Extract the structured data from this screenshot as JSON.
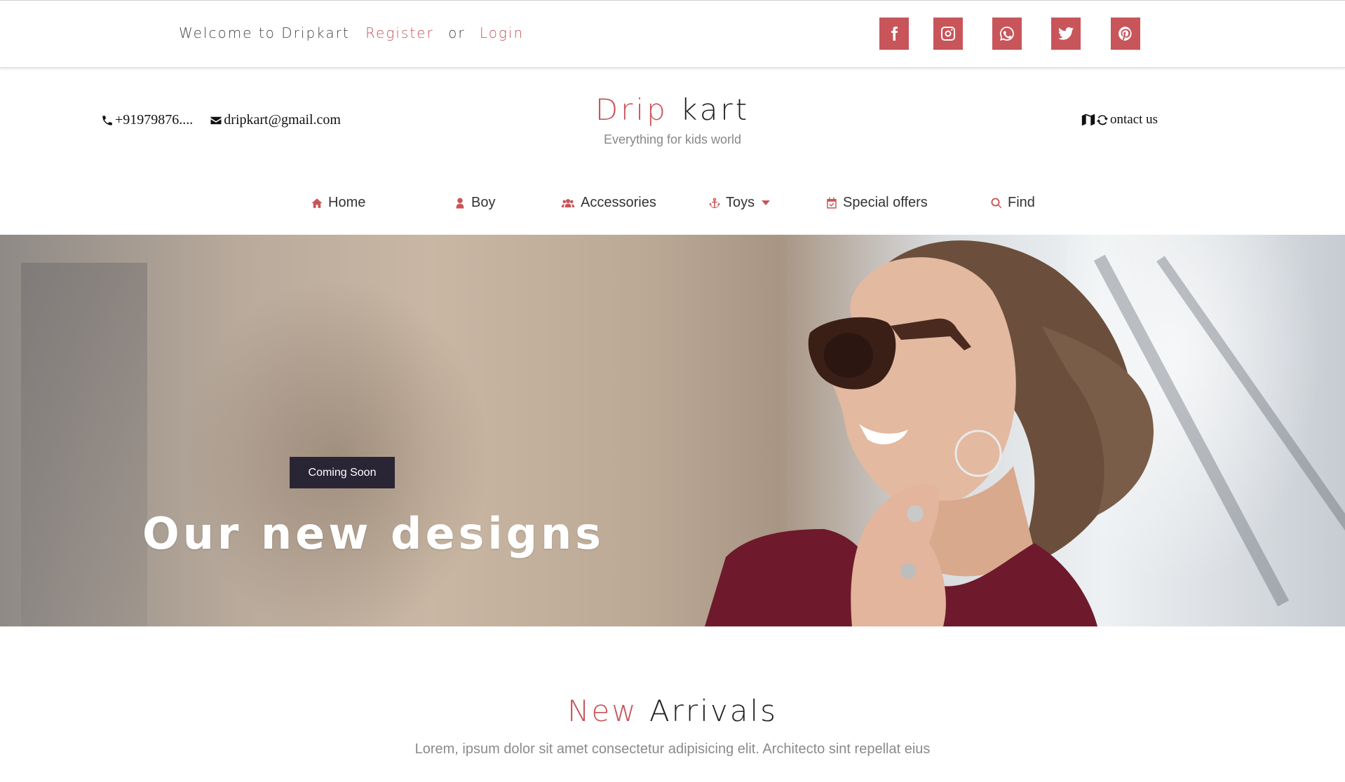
{
  "topbar": {
    "welcome": "Welcome to Dripkart",
    "register": "Register",
    "or": "or",
    "login": "Login",
    "social": [
      "facebook-icon",
      "instagram-icon",
      "whatsapp-icon",
      "twitter-icon",
      "pinterest-icon"
    ]
  },
  "header": {
    "phone": "+91979876....",
    "email": "dripkart@gmail.com",
    "brand_part1": "Drip",
    "brand_part2": "kart",
    "tagline": "Everything for kids world",
    "contact": "ontact us"
  },
  "nav": {
    "items": [
      {
        "label": "Home",
        "icon": "home-icon"
      },
      {
        "label": "Boy",
        "icon": "user-icon"
      },
      {
        "label": "Accessories",
        "icon": "users-icon"
      },
      {
        "label": "Toys",
        "icon": "anchor-icon"
      },
      {
        "label": "Special offers",
        "icon": "calendar-check-icon"
      },
      {
        "label": "Find",
        "icon": "search-icon"
      }
    ]
  },
  "hero": {
    "badge": "Coming Soon",
    "title": "Our new designs"
  },
  "section": {
    "title_part1": "New",
    "title_part2": "Arrivals",
    "subtitle": "Lorem, ipsum dolor sit amet consectetur adipisicing elit. Architecto sint repellat eius"
  },
  "colors": {
    "accent": "#c8555a",
    "badge_bg": "#2a2535"
  }
}
